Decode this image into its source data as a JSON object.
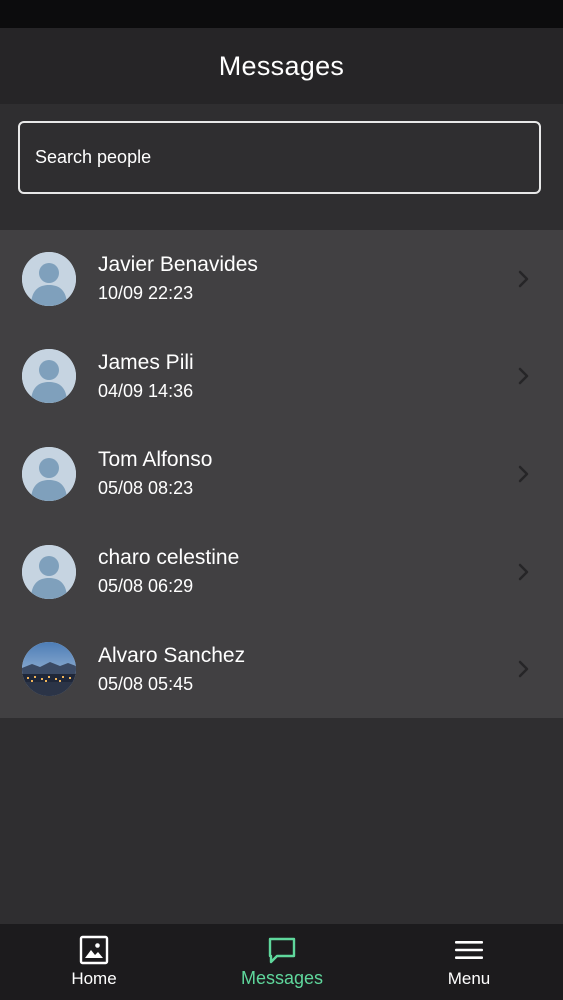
{
  "header": {
    "title": "Messages"
  },
  "search": {
    "placeholder": "Search people"
  },
  "conversations": [
    {
      "name": "Javier Benavides",
      "time": "10/09 22:23",
      "avatar": "default-avatar-icon"
    },
    {
      "name": "James Pili",
      "time": "04/09 14:36",
      "avatar": "default-avatar-icon"
    },
    {
      "name": "Tom Alfonso",
      "time": "05/08 08:23",
      "avatar": "default-avatar-icon"
    },
    {
      "name": "charo celestine",
      "time": "05/08 06:29",
      "avatar": "default-avatar-icon"
    },
    {
      "name": "Alvaro Sanchez",
      "time": "05/08 05:45",
      "avatar": "city-night-photo"
    }
  ],
  "tabs": [
    {
      "label": "Home",
      "icon": "gallery-icon",
      "active": false
    },
    {
      "label": "Messages",
      "icon": "chat-bubble-icon",
      "active": true
    },
    {
      "label": "Menu",
      "icon": "hamburger-menu-icon",
      "active": false
    }
  ],
  "colors": {
    "accent": "#5fd79c",
    "list_background": "#414042",
    "page_background": "#2f2e30",
    "header_background": "#262527",
    "tabbar_background": "#1c1b1d"
  }
}
